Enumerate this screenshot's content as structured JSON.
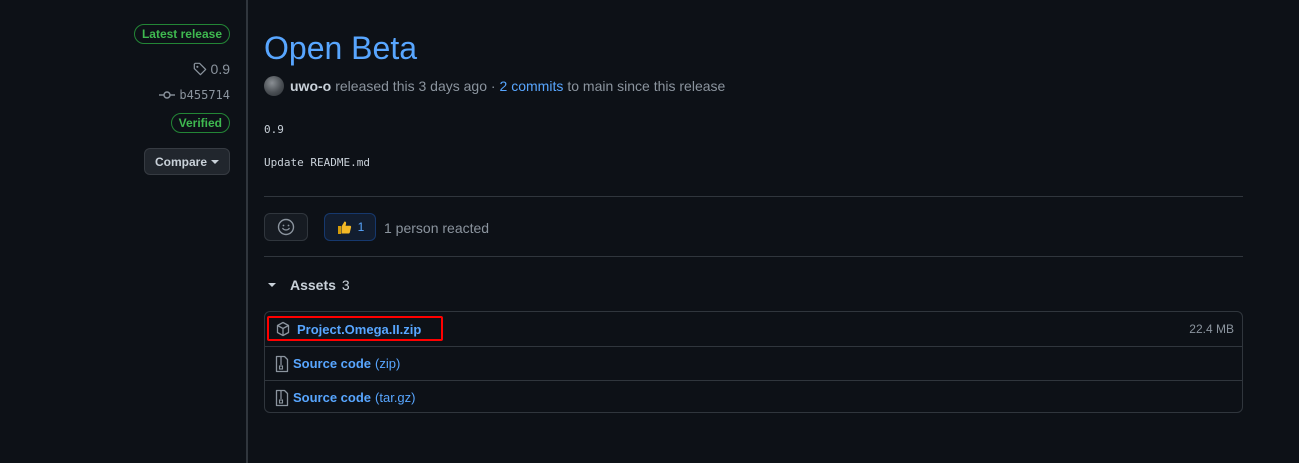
{
  "sidebar": {
    "latest_badge": "Latest release",
    "tag": "0.9",
    "commit": "b455714",
    "verified_badge": "Verified",
    "compare_label": "Compare"
  },
  "release": {
    "title": "Open Beta",
    "author": "uwo-o",
    "released_text": "released this 3 days ago ·",
    "commits_link": "2 commits",
    "since_text": "to main since this release",
    "notes": [
      "0.9",
      "Update README.md"
    ]
  },
  "reactions": {
    "thumbs_count": "1",
    "summary": "1 person reacted"
  },
  "assets": {
    "label": "Assets",
    "count": "3",
    "items": [
      {
        "name": "Project.Omega.II.zip",
        "suffix": "",
        "size": "22.4 MB",
        "icon": "package-icon"
      },
      {
        "name": "Source code",
        "suffix": "(zip)",
        "size": "",
        "icon": "file-zip-icon"
      },
      {
        "name": "Source code",
        "suffix": "(tar.gz)",
        "size": "",
        "icon": "file-zip-icon"
      }
    ]
  },
  "colors": {
    "background": "#0d1117",
    "link": "#58a6ff",
    "badge_green": "#3fb950",
    "highlight": "#ff0000"
  }
}
